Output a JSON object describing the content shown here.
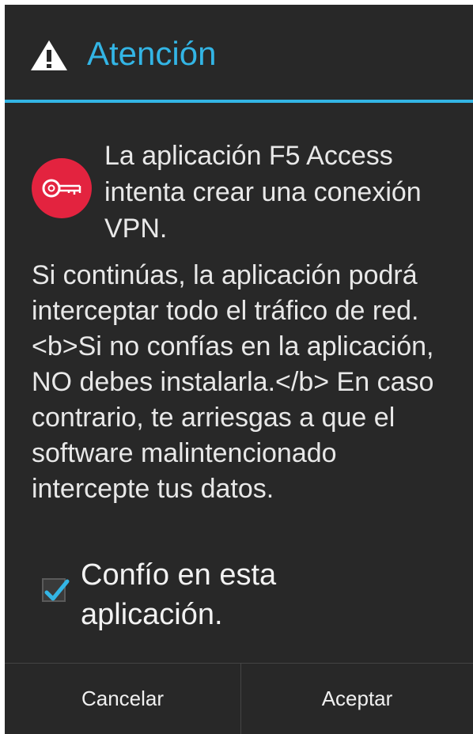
{
  "dialog": {
    "title": "Atención",
    "accent_color": "#33b5e5",
    "warning_icon": "warning-triangle-icon",
    "app_icon": "key-icon",
    "app_icon_color": "#e3233f",
    "app_message": "La aplicación F5 Access intenta crear una conexión VPN.",
    "body_message": "Si continúas, la aplicación podrá interceptar todo el tráfico de red. <b>Si no confías en la aplicación, NO debes instalarla.</b> En caso contrario, te arriesgas a que el software malintencionado intercepte tus datos.",
    "trust_checkbox": {
      "label": "Confío en esta aplicación.",
      "checked": true
    },
    "buttons": {
      "cancel": "Cancelar",
      "accept": "Aceptar"
    }
  }
}
